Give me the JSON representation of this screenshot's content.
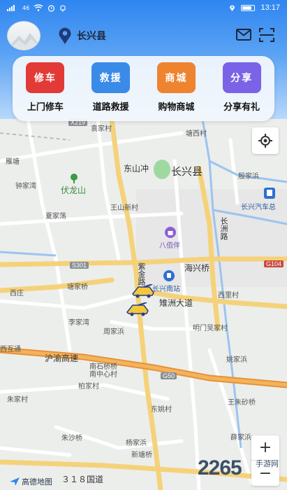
{
  "status_bar": {
    "left_indicator": "46",
    "time": "13:17"
  },
  "header": {
    "city": "长兴县",
    "icons": {
      "location": "location-pin-icon",
      "mail": "mail-icon",
      "scan": "scan-icon"
    }
  },
  "services": [
    {
      "button": "修车",
      "label": "上门修车",
      "color": "#e23a36"
    },
    {
      "button": "救援",
      "label": "道路救援",
      "color": "#3a8ae8"
    },
    {
      "button": "商城",
      "label": "购物商城",
      "color": "#ee8430"
    },
    {
      "button": "分享",
      "label": "分享有礼",
      "color": "#7a63e6"
    }
  ],
  "map": {
    "place_labels": {
      "dongshanchong": "东山冲",
      "changxing": "长兴县",
      "tangxicun": "塘西村",
      "yintang": "雁塘",
      "zhongjiawan": "钟家湾",
      "fulongshan": "伏龙山",
      "jiajiacun": "袁家村",
      "yinjiabang": "殷家浜",
      "changxing_auto": "长兴汽车总",
      "xiajiadang": "夏家荡",
      "wangshanxin": "王山新村",
      "changzhou_road": "长洲路",
      "babaiban": "八佰伴",
      "haixingqiao": "海兴桥",
      "zijin_road": "紫金路",
      "changxing_south": "长兴南站",
      "tangjiaqiao": "塘家桥",
      "xizhuang": "西庄",
      "zhizhou_ave": "雉洲大道",
      "xilicun": "西里村",
      "lijiawan": "李家湾",
      "zhoujiabang": "周家浜",
      "mingmen": "明门吴家村",
      "xihutong": "西互通",
      "huyu": "沪渝高速",
      "nanshiqiao": "南石桥桥",
      "nanzhongxin": "南中心村",
      "yaojiabang": "姚家浜",
      "bojiacun": "柏家村",
      "zhujiacun": "朱家村",
      "dongyao": "东姚村",
      "wangzhusha": "王朱砂桥",
      "zhushaqiao": "朱沙桥",
      "yangjiabang": "杨家浜",
      "xuejia": "薛家浜",
      "xintangqiao": "新塘桥",
      "road318": "３１８国道"
    },
    "road_badges": {
      "s301": "S301",
      "g104": "G104",
      "g50": "G50",
      "s_top": "X219"
    },
    "poi_icons": [
      "tree-icon",
      "shopping-mall-icon",
      "train-station-icon",
      "bus-station-icon"
    ],
    "controls": {
      "zoom_in": "+",
      "zoom_out": "−"
    },
    "vehicles": [
      "tow-truck-icon",
      "tow-truck-icon"
    ],
    "logo": "高德地图",
    "watermark": "2265",
    "watermark_sub": "手游网"
  }
}
